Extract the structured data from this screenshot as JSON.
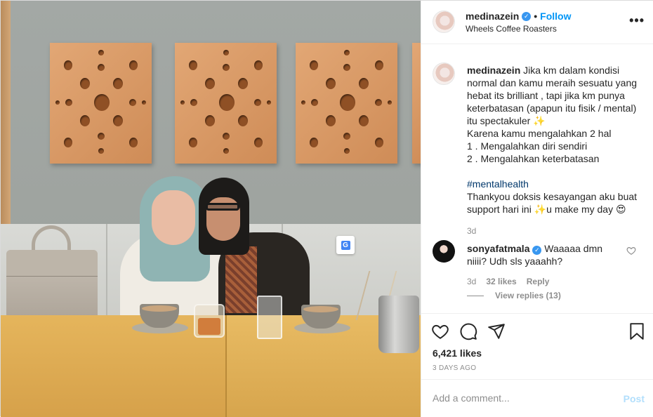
{
  "header": {
    "username": "medinazein",
    "verified_icon": "verified-badge-icon",
    "separator": "•",
    "follow_label": "Follow",
    "location": "Wheels Coffee Roasters",
    "more_label": "•••"
  },
  "caption": {
    "username": "medinazein",
    "text": "Jika km dalam kondisi normal dan kamu meraih sesuatu yang hebat its brilliant , tapi jika km punya keterbatasan (apapun itu fisik / mental) itu spectakuler ✨\nKarena kamu mengalahkan 2 hal\n1 . Mengalahkan diri sendiri\n2 . Mengalahkan keterbatasan",
    "hashtag": "#mentalhealth",
    "text_after": "Thankyou doksis kesayangan aku buat support hari ini ✨u make my day 😍",
    "timestamp": "3d"
  },
  "comment": {
    "username": "sonyafatmala",
    "text": "Waaaaa dmn niiii? Udh sls yaaahh?",
    "timestamp": "3d",
    "likes": "32 likes",
    "reply_label": "Reply",
    "view_replies": "View replies (13)"
  },
  "actions": {
    "likes": "6,421 likes",
    "posted_ago": "3 DAYS AGO"
  },
  "add_comment": {
    "placeholder": "Add a comment...",
    "post_label": "Post"
  },
  "colors": {
    "link_blue": "#0095f6",
    "verified_blue": "#3897f0",
    "muted": "#8e8e8e",
    "post_disabled": "#b2dffc"
  }
}
